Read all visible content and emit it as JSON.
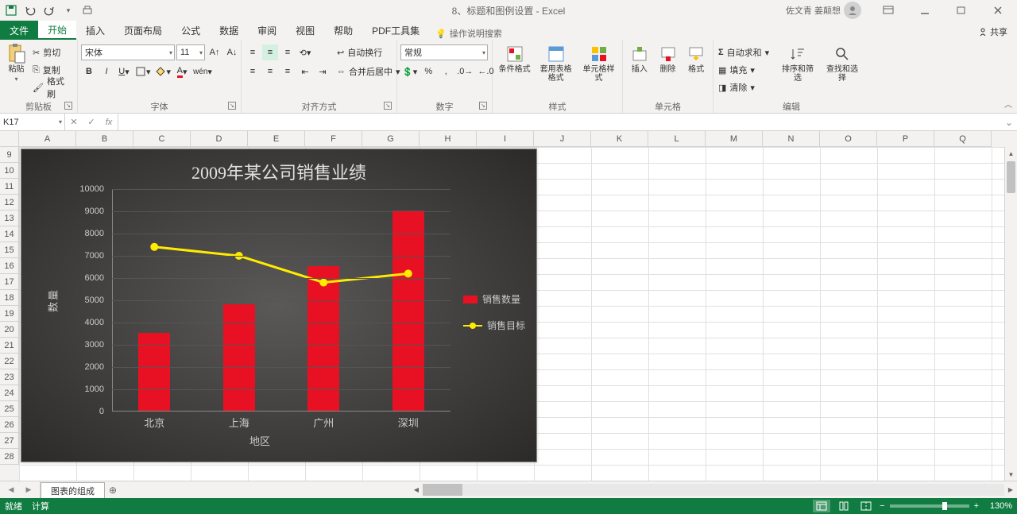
{
  "titlebar": {
    "doc_title": "8、标题和图例设置 - Excel",
    "user_name": "佐文青 姜颠想"
  },
  "tabs": {
    "file": "文件",
    "items": [
      "开始",
      "插入",
      "页面布局",
      "公式",
      "数据",
      "审阅",
      "视图",
      "帮助",
      "PDF工具集"
    ],
    "tellme_placeholder": "操作说明搜索",
    "share": "共享"
  },
  "ribbon": {
    "clipboard": {
      "paste": "粘贴",
      "cut": "剪切",
      "copy": "复制",
      "format_painter": "格式刷",
      "label": "剪贴板"
    },
    "font": {
      "name": "宋体",
      "size": "11",
      "label": "字体"
    },
    "align": {
      "wrap": "自动换行",
      "merge": "合并后居中",
      "label": "对齐方式"
    },
    "number": {
      "format": "常规",
      "label": "数字"
    },
    "styles": {
      "cond": "条件格式",
      "table": "套用表格格式",
      "cell": "单元格样式",
      "label": "样式"
    },
    "cells": {
      "insert": "插入",
      "delete": "删除",
      "format": "格式",
      "label": "单元格"
    },
    "editing": {
      "autosum": "自动求和",
      "fill": "填充",
      "clear": "清除",
      "sort": "排序和筛选",
      "find": "查找和选择",
      "label": "编辑"
    }
  },
  "formulabar": {
    "cell_ref": "K17",
    "formula": ""
  },
  "grid": {
    "cols": [
      "A",
      "B",
      "C",
      "D",
      "E",
      "F",
      "G",
      "H",
      "I",
      "J",
      "K",
      "L",
      "M",
      "N",
      "O",
      "P",
      "Q"
    ],
    "first_row": 9,
    "row_count": 20
  },
  "chart_data": {
    "type": "bar_line_combo",
    "title": "2009年某公司销售业绩",
    "xlabel": "地区",
    "ylabel": "数量",
    "ylim": [
      0,
      10000
    ],
    "ytick_step": 1000,
    "categories": [
      "北京",
      "上海",
      "广州",
      "深圳"
    ],
    "series": [
      {
        "name": "销售数量",
        "type": "bar",
        "color": "#e81123",
        "values": [
          3500,
          4800,
          6500,
          9000
        ]
      },
      {
        "name": "销售目标",
        "type": "line",
        "color": "#ffeb00",
        "values": [
          7400,
          7000,
          5800,
          6200
        ]
      }
    ]
  },
  "sheets": {
    "active": "图表的组成"
  },
  "statusbar": {
    "ready": "就绪",
    "calc": "计算",
    "zoom": "130%"
  }
}
